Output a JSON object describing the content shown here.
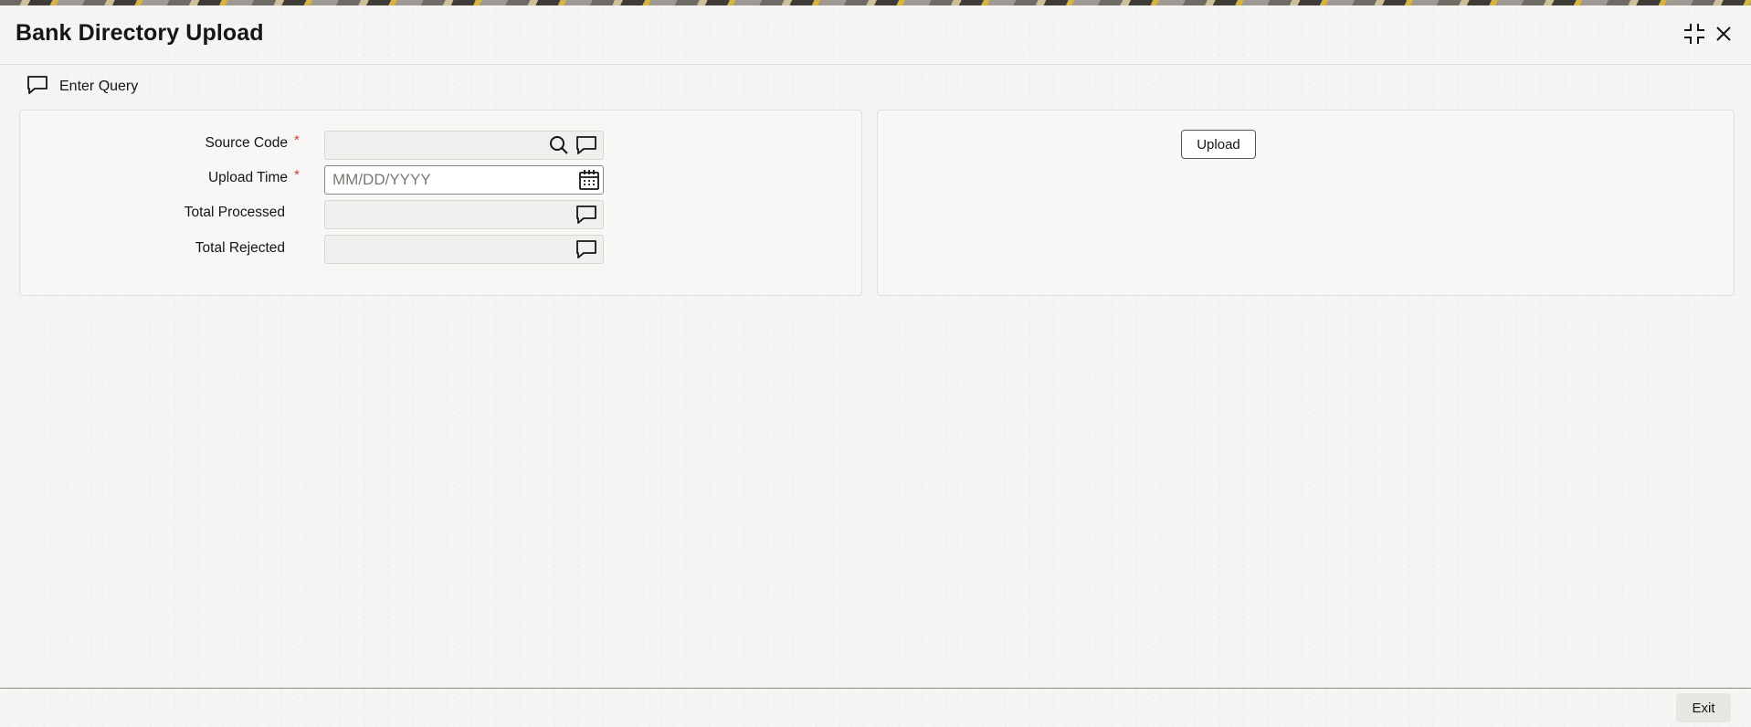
{
  "window": {
    "title": "Bank Directory Upload",
    "icons": [
      "maximize-icon",
      "close-icon"
    ]
  },
  "toolbar": {
    "enter_query_label": "Enter Query",
    "enter_query_icon": "speech-bubble-icon"
  },
  "form": {
    "source_code": {
      "label": "Source Code",
      "required_mark": "*",
      "value": ""
    },
    "upload_time": {
      "label": "Upload Time",
      "required_mark": "*",
      "value": "",
      "placeholder": "MM/DD/YYYY"
    },
    "total_processed": {
      "label": "Total Processed",
      "value": ""
    },
    "total_rejected": {
      "label": "Total Rejected",
      "value": ""
    }
  },
  "actions": {
    "upload_label": "Upload"
  },
  "footer": {
    "exit_label": "Exit"
  },
  "colors": {
    "required": "#c74634",
    "text": "#161513",
    "panel_bg": "#f8f7f5"
  }
}
